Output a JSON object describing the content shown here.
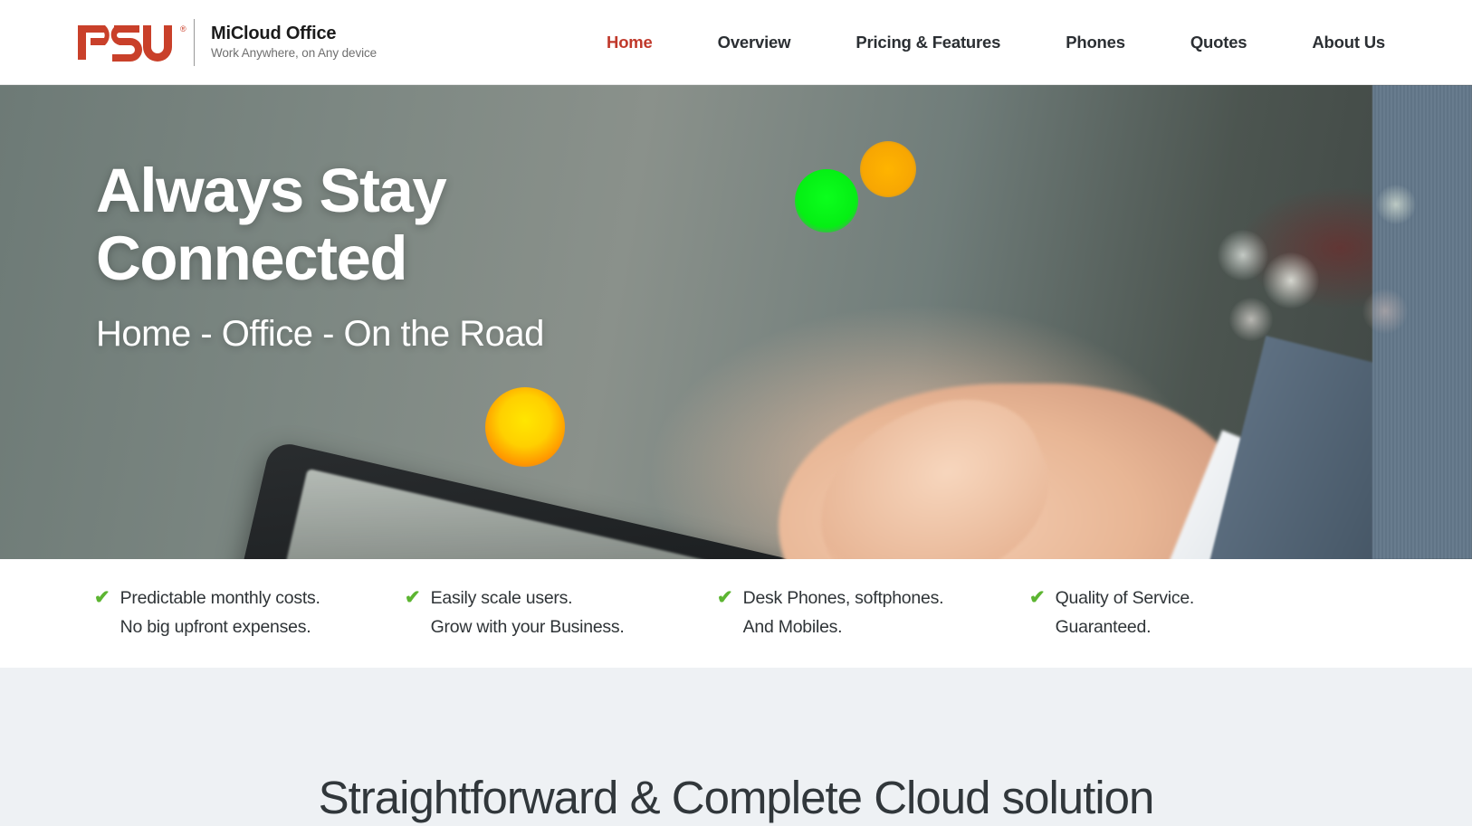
{
  "header": {
    "logo": {
      "mark_text": "PSU",
      "registered": "®",
      "title": "MiCloud Office",
      "tagline": "Work Anywhere, on Any device"
    },
    "nav": [
      {
        "label": "Home",
        "active": true
      },
      {
        "label": "Overview",
        "active": false
      },
      {
        "label": "Pricing & Features",
        "active": false
      },
      {
        "label": "Phones",
        "active": false
      },
      {
        "label": "Quotes",
        "active": false
      },
      {
        "label": "About Us",
        "active": false
      }
    ]
  },
  "hero": {
    "title_line1": "Always Stay",
    "title_line2": "Connected",
    "subtitle": "Home - Office - On the Road"
  },
  "bullets": [
    {
      "line1": "Predictable monthly costs.",
      "line2": "No big upfront expenses."
    },
    {
      "line1": "Easily scale users.",
      "line2": "Grow with your Business."
    },
    {
      "line1": "Desk Phones, softphones.",
      "line2": "And Mobiles."
    },
    {
      "line1": "Quality of Service.",
      "line2": "Guaranteed."
    }
  ],
  "lower": {
    "heading": "Straightforward & Complete Cloud solution"
  },
  "colors": {
    "brand_red": "#c0392b",
    "logo_red": "#c9402a",
    "check_green": "#5cb531",
    "nav_text": "#2b2f33",
    "lower_bg": "#eef1f4",
    "heading_text": "#31373b"
  },
  "icons": {
    "check": "✔"
  }
}
